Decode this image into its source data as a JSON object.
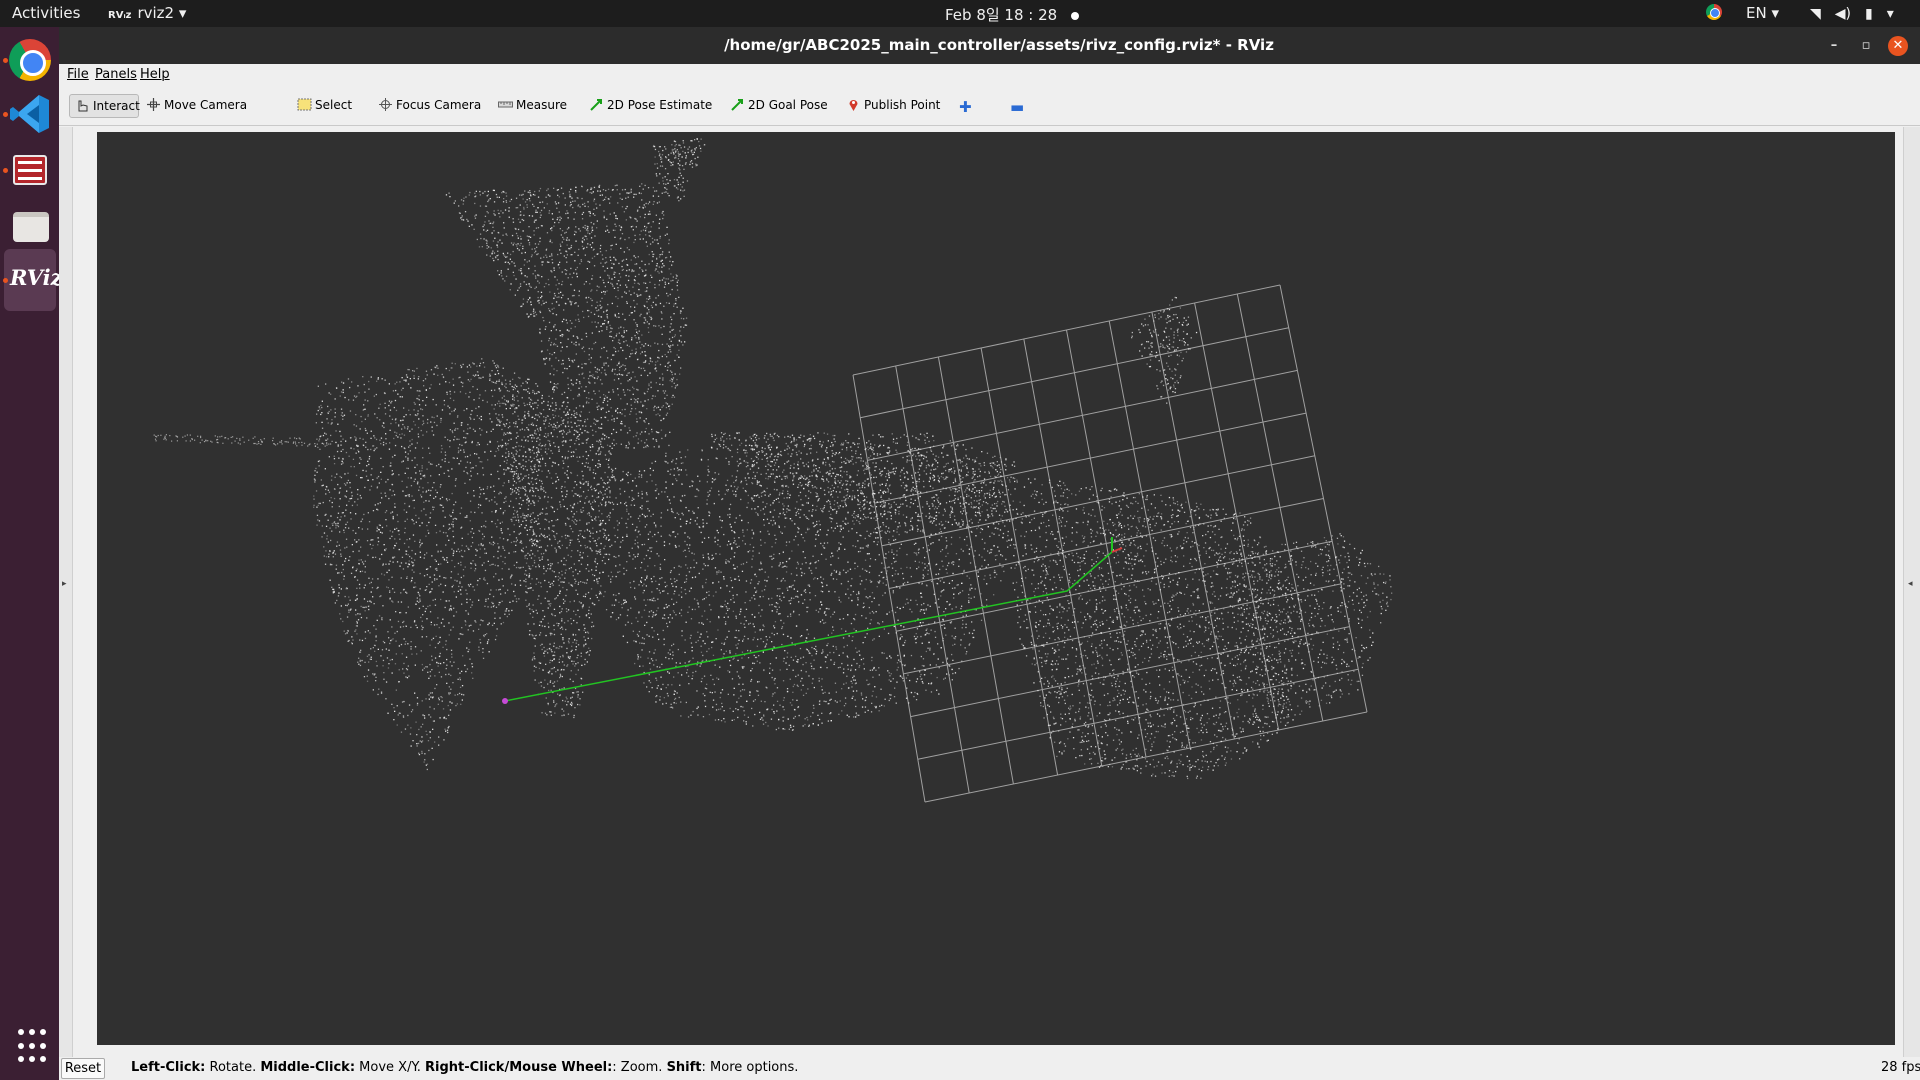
{
  "topbar": {
    "activities": "Activities",
    "app_menu": "rviz2",
    "app_menu_icon_text": "RVᵢᴢ",
    "clock": "Feb 8일  18 : 28",
    "language": "EN",
    "tray_icons": [
      "wifi-icon",
      "volume-icon",
      "battery-icon",
      "power-menu-icon"
    ]
  },
  "dock": {
    "apps": [
      "Google Chrome",
      "Visual Studio Code",
      "Terminal",
      "Files",
      "RViz"
    ],
    "rviz_label": "RViz"
  },
  "window": {
    "title": "/home/gr/ABC2025_main_controller/assets/rivz_config.rviz* - RViz"
  },
  "menu": {
    "file": "File",
    "panels": "Panels",
    "help": "Help"
  },
  "toolbar": {
    "interact": "Interact",
    "move_camera": "Move Camera",
    "select": "Select",
    "focus_camera": "Focus Camera",
    "measure": "Measure",
    "pose_estimate": "2D Pose Estimate",
    "goal_pose": "2D Goal Pose",
    "publish_point": "Publish Point",
    "add_tool": "✚",
    "remove_tool": "▬"
  },
  "viewport": {
    "background_color": "#303030",
    "grid_color": "#a0a0a0",
    "cloud_color": "#e8e8e8",
    "path_color": "#22c422"
  },
  "statusbar": {
    "reset": "Reset",
    "hint_1_bold": "Left-Click:",
    "hint_1": " Rotate. ",
    "hint_2_bold": "Middle-Click:",
    "hint_2": " Move X/Y. ",
    "hint_3_bold": "Right-Click/Mouse Wheel:",
    "hint_3": ": Zoom. ",
    "hint_4_bold": "Shift",
    "hint_4": ": More options.",
    "fps": "28 fps"
  }
}
